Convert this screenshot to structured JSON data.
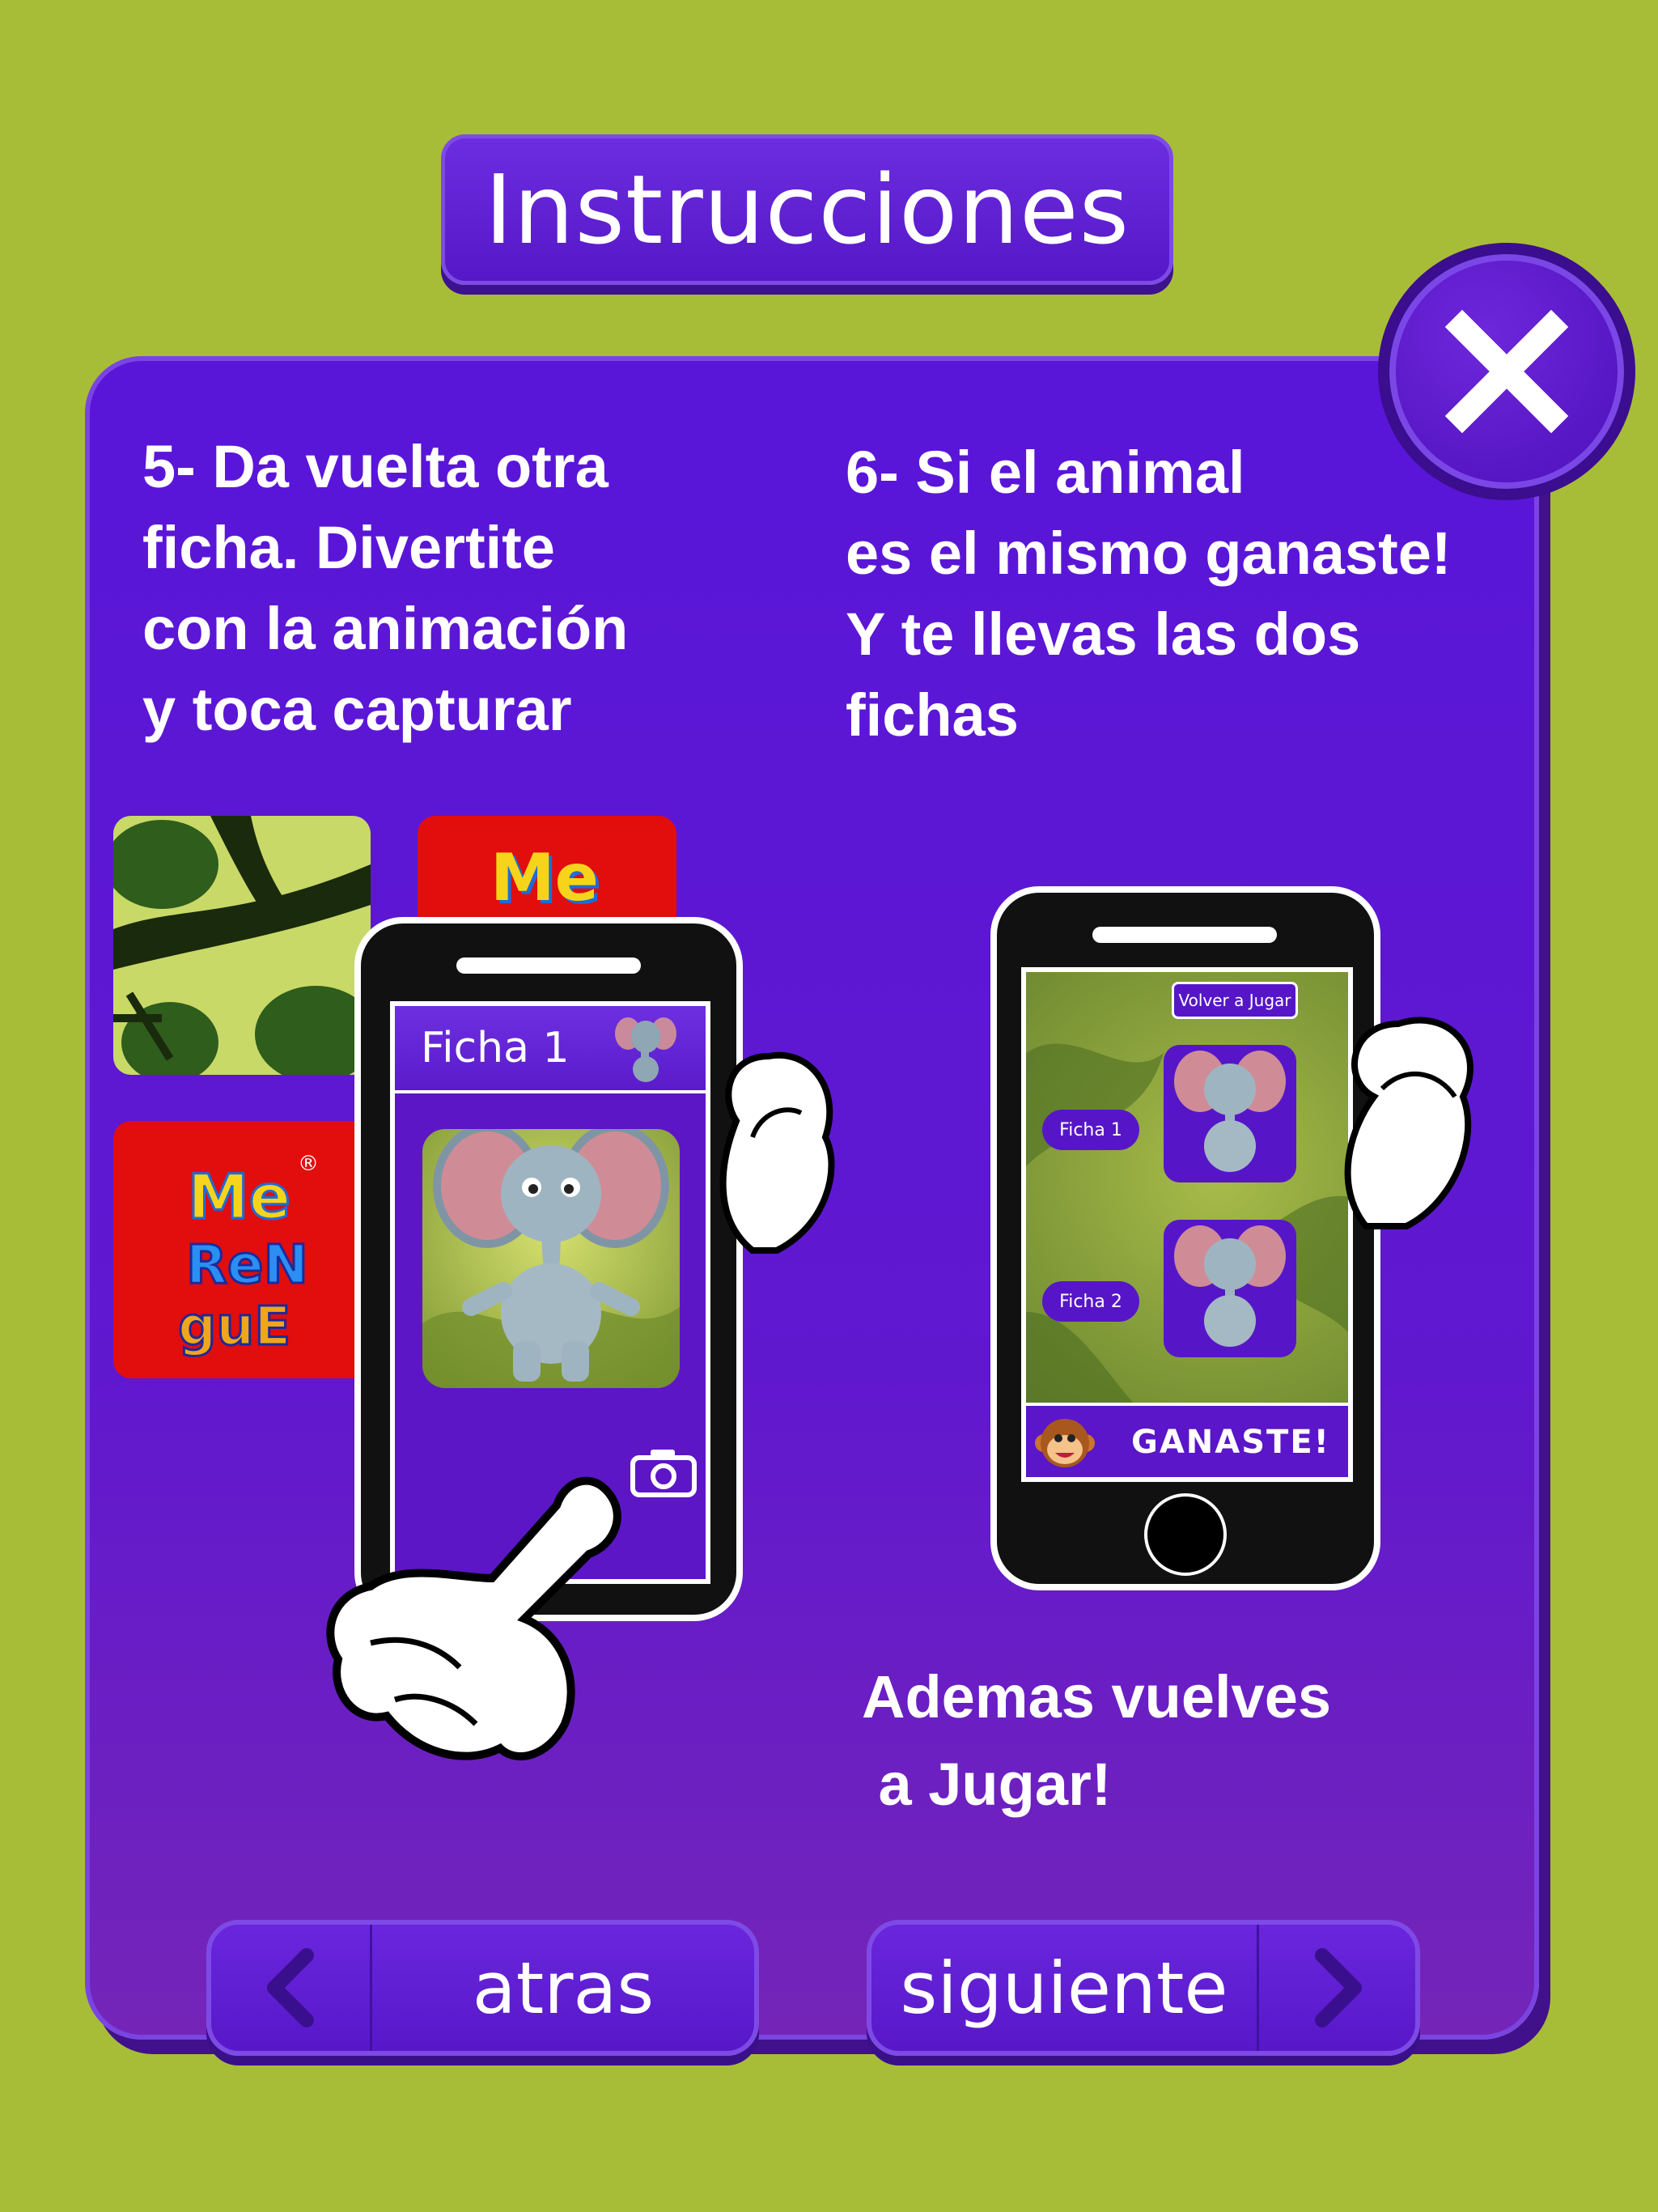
{
  "header": {
    "title": "Instrucciones"
  },
  "close": {
    "icon": "close-icon"
  },
  "step5": {
    "lines": [
      "5- Da vuelta otra",
      "ficha. Divertite",
      "con la animación",
      "y toca capturar"
    ]
  },
  "step6": {
    "lines": [
      "6- Si el animal",
      "es el mismo ganaste!",
      "Y te llevas las dos",
      "fichas"
    ]
  },
  "extra": {
    "lines": [
      "Ademas vuelves",
      " a Jugar!"
    ]
  },
  "logo": {
    "text": "MeRenguE",
    "mark": "®"
  },
  "phone1": {
    "title": "Ficha 1",
    "camera_icon": "camera-icon"
  },
  "phone2": {
    "replay_label": "Volver a Jugar",
    "slot1_label": "Ficha 1",
    "slot2_label": "Ficha 2",
    "win_text": "GANASTE!"
  },
  "nav": {
    "back_label": "atras",
    "next_label": "siguiente",
    "back_icon": "chevron-left-icon",
    "next_icon": "chevron-right-icon"
  },
  "colors": {
    "background": "#a8bd37",
    "panel": "#5a17d6",
    "accent": "#7a44e2",
    "card_red": "#e20d0d"
  }
}
